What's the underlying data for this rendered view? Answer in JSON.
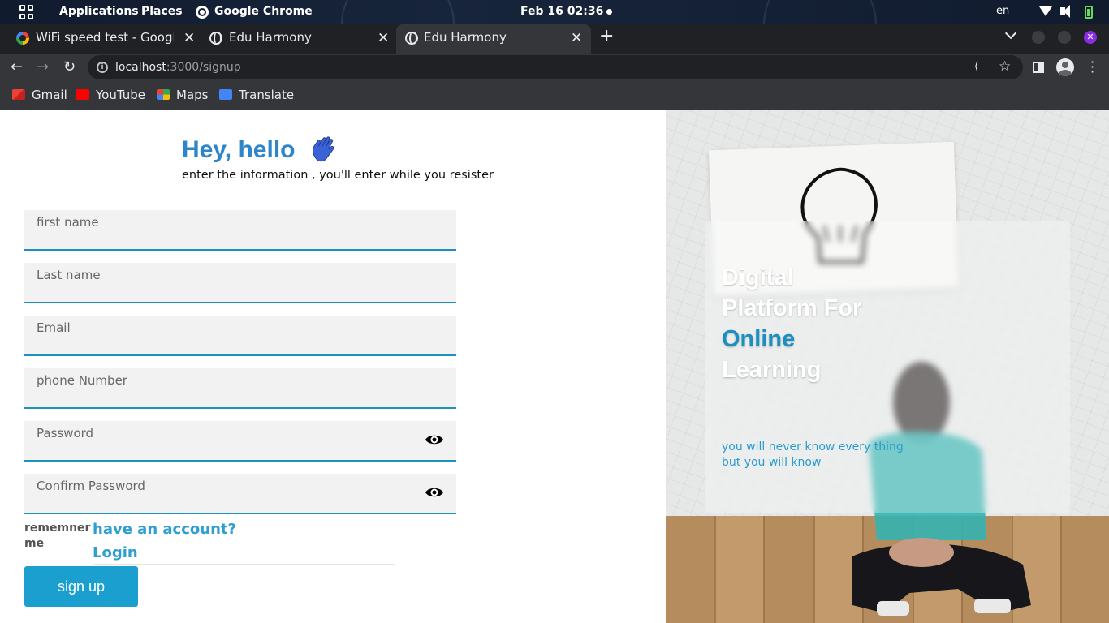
{
  "system_bar": {
    "applications": "Applications",
    "places": "Places",
    "app_name": "Google Chrome",
    "datetime": "Feb 16  02:36",
    "lang": "en"
  },
  "browser": {
    "tabs": [
      {
        "title": "WiFi speed test - Google s",
        "favicon": "google-icon",
        "active": false
      },
      {
        "title": "Edu Harmony",
        "favicon": "globe-icon",
        "active": false
      },
      {
        "title": "Edu Harmony",
        "favicon": "globe-icon",
        "active": true
      }
    ],
    "url_host": "localhost",
    "url_path": ":3000/signup",
    "bookmarks": [
      {
        "label": "Gmail",
        "icon": "gmail-icon"
      },
      {
        "label": "YouTube",
        "icon": "youtube-icon"
      },
      {
        "label": "Maps",
        "icon": "maps-icon"
      },
      {
        "label": "Translate",
        "icon": "translate-icon"
      }
    ]
  },
  "signup": {
    "greeting": "Hey, hello",
    "subtitle": "enter the information , you'll enter while you resister",
    "fields": {
      "first_name": "first name",
      "last_name": "Last name",
      "email": "Email",
      "phone": "phone Number",
      "password": "Password",
      "confirm_password": "Confirm Password"
    },
    "remember_me": "rememner me",
    "have_account": "have an account?",
    "login": "Login",
    "submit": "sign up"
  },
  "hero": {
    "line1": "Digital",
    "line2": "Platform For",
    "line3": "Online",
    "line4": "Learning",
    "tagline": "you will never know every thing but you will know"
  },
  "colors": {
    "accent": "#1b9fcf",
    "heading": "#2e86c9",
    "field_bg": "#f2f2f2"
  }
}
